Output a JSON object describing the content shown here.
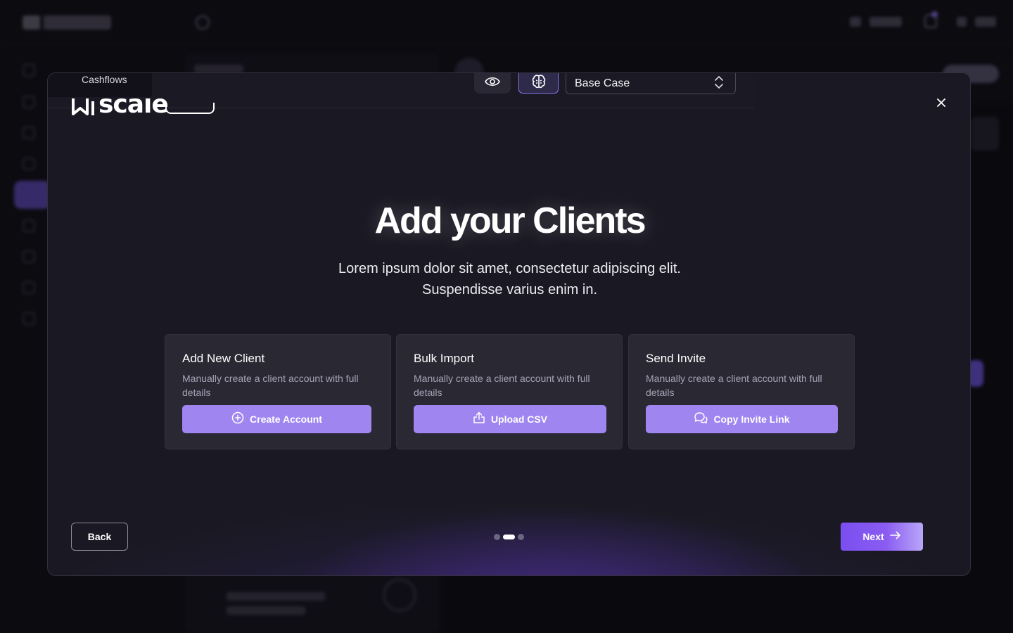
{
  "modal": {
    "tab_label": "Cashflows",
    "scenario_value": "Base Case",
    "brand_name": "scale",
    "title": "Add your Clients",
    "subtitle_line1": "Lorem ipsum dolor sit amet, consectetur adipiscing elit.",
    "subtitle_line2": "Suspendisse varius enim in.",
    "cards": [
      {
        "title": "Add New Client",
        "description": "Manually create a client account with full details",
        "button_label": "Create Account",
        "icon": "plus-circle-icon"
      },
      {
        "title": "Bulk Import",
        "description": "Manually create a client account with full details",
        "button_label": "Upload CSV",
        "icon": "upload-icon"
      },
      {
        "title": "Send Invite",
        "description": "Manually create a client account with full details",
        "button_label": "Copy Invite Link",
        "icon": "chat-bubbles-icon"
      }
    ],
    "back_label": "Back",
    "next_label": "Next",
    "pagination": {
      "total": 3,
      "current": 2
    }
  },
  "colors": {
    "accent": "#9f85f0",
    "primary": "#7a4ff0",
    "modal_bg": "#1a1923",
    "card_bg": "#2a2833"
  }
}
